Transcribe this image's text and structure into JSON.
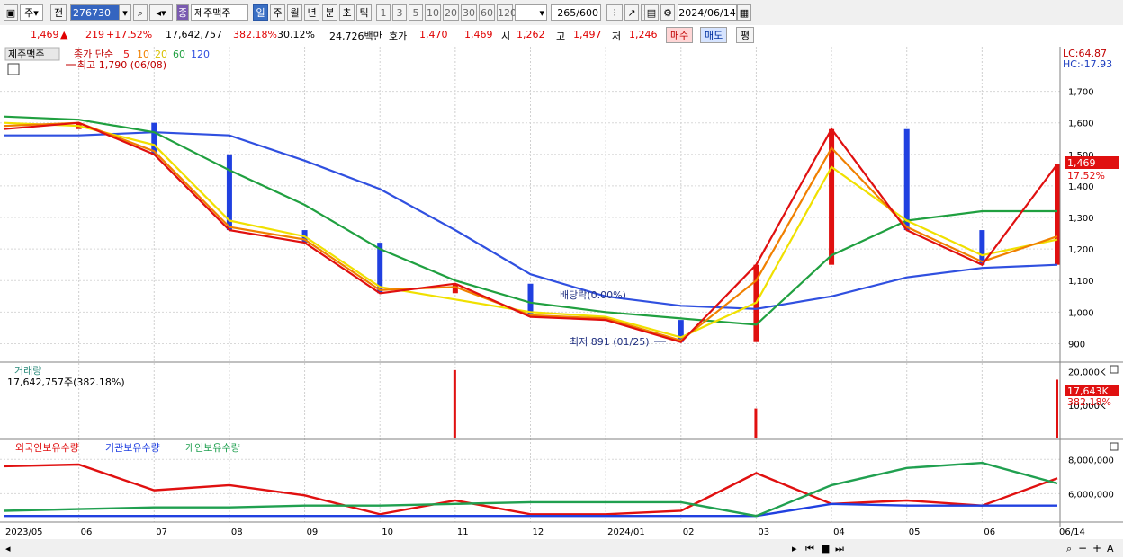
{
  "toolbar": {
    "market": "주",
    "prev": "전",
    "code": "276730",
    "name": "제주맥주",
    "name_badge": "종",
    "periods": [
      "일",
      "주",
      "월",
      "년",
      "분",
      "초",
      "틱"
    ],
    "active_period": "일",
    "intervals": [
      "1",
      "3",
      "5",
      "10",
      "20",
      "30",
      "60",
      "120"
    ],
    "count": "265",
    "count_total": "/600",
    "date": "2024/06/14"
  },
  "quote": {
    "price": "1,469",
    "change": "219",
    "change_arrow": "▲",
    "change_pct": "+17.52%",
    "volume": "17,642,757",
    "volume_ratio": "382.18%",
    "turnover": "30.12%",
    "amount": "24,726백만",
    "ask_label": "호가",
    "ask": "1,470",
    "bid": "1,469",
    "open_label": "시",
    "open": "1,262",
    "high_label": "고",
    "high": "1,497",
    "low_label": "저",
    "low": "1,246",
    "buy_btn": "매수",
    "sell_btn": "매도",
    "eval_btn": "평"
  },
  "price_panel": {
    "title": "제주맥주",
    "ma_label": "종가 단순",
    "ma_periods": [
      "5",
      "10",
      "20",
      "60",
      "120"
    ],
    "ma_colors": [
      "#e01010",
      "#f08000",
      "#f0e000",
      "#20a040",
      "#3050e0"
    ],
    "high_marker": "최고 1,790 (06/08)",
    "low_marker": "최저 891 (01/25)",
    "dividend_marker": "배당락(0.00%)",
    "lc_label": "LC:64.87",
    "hc_label": "HC:-17.93",
    "price_tag": "1,469",
    "pct_tag": "17.52%"
  },
  "volume_panel": {
    "title": "거래량",
    "value_text": "17,642,757주(382.18%)",
    "tag": "17,643K",
    "tag_pct": "382.18%"
  },
  "holding_panel": {
    "series_labels": [
      "외국인보유수량",
      "기관보유수량",
      "개인보유수량"
    ],
    "series_colors": [
      "#e01010",
      "#2040e0",
      "#20a050"
    ]
  },
  "x_axis": {
    "labels": [
      "2023/05",
      "06",
      "07",
      "08",
      "09",
      "10",
      "11",
      "12",
      "2024/01",
      "02",
      "03",
      "04",
      "05",
      "06",
      "06/14"
    ]
  },
  "chart_data": [
    {
      "type": "line",
      "title": "제주맥주",
      "y_ticks": [
        "1,700",
        "1,600",
        "1,500",
        "1,400",
        "1,300",
        "1,200",
        "1,100",
        "1,000",
        "900"
      ],
      "ylim": [
        850,
        1790
      ],
      "x": [
        "2023/05",
        "2023/06",
        "2023/07",
        "2023/08",
        "2023/09",
        "2023/10",
        "2023/11",
        "2023/12",
        "2024/01",
        "2024/02",
        "2024/03",
        "2024/04",
        "2024/05",
        "2024/06",
        "06/14"
      ],
      "series": [
        {
          "name": "5",
          "values": [
            1580,
            1600,
            1500,
            1260,
            1220,
            1060,
            1090,
            985,
            975,
            905,
            1150,
            1580,
            1260,
            1150,
            1469
          ]
        },
        {
          "name": "10",
          "values": [
            1590,
            1600,
            1510,
            1270,
            1230,
            1070,
            1080,
            990,
            980,
            910,
            1100,
            1520,
            1270,
            1160,
            1240
          ]
        },
        {
          "name": "20",
          "values": [
            1600,
            1590,
            1530,
            1290,
            1240,
            1080,
            1040,
            1000,
            985,
            920,
            1030,
            1460,
            1290,
            1180,
            1230
          ]
        },
        {
          "name": "60",
          "values": [
            1620,
            1610,
            1570,
            1450,
            1340,
            1200,
            1100,
            1030,
            1000,
            980,
            960,
            1180,
            1290,
            1320,
            1320
          ]
        },
        {
          "name": "120",
          "values": [
            1560,
            1560,
            1570,
            1560,
            1480,
            1390,
            1260,
            1120,
            1050,
            1020,
            1010,
            1050,
            1110,
            1140,
            1150
          ]
        }
      ],
      "annotations": [
        "최고 1,790 (06/08)",
        "최저 891 (01/25)",
        "배당락(0.00%)"
      ]
    },
    {
      "type": "bar",
      "title": "거래량",
      "y_ticks": [
        "20,000K",
        "10,000K"
      ],
      "ylim": [
        0,
        21000
      ],
      "spikes": [
        {
          "x": "2023/11",
          "value": 20500
        },
        {
          "x": "2024/03",
          "value": 9000
        },
        {
          "x": "06/14",
          "value": 17643
        }
      ]
    },
    {
      "type": "line",
      "title": "외국인보유수량 기관보유수량 개인보유수량",
      "y_ticks": [
        "8,000,000",
        "6,000,000"
      ],
      "ylim": [
        4500000,
        8800000
      ],
      "x": [
        "2023/05",
        "2023/06",
        "2023/07",
        "2023/08",
        "2023/09",
        "2023/10",
        "2023/11",
        "2023/12",
        "2024/01",
        "2024/02",
        "2024/03",
        "2024/04",
        "2024/05",
        "2024/06",
        "06/14"
      ],
      "series": [
        {
          "name": "외국인보유수량",
          "values": [
            7600,
            7700,
            6200,
            6500,
            5900,
            4800,
            5600,
            4800,
            4800,
            5000,
            7200,
            5400,
            5600,
            5300,
            6900
          ]
        },
        {
          "name": "기관보유수량",
          "values": [
            4700,
            4700,
            4700,
            4700,
            4700,
            4700,
            4700,
            4700,
            4700,
            4700,
            4700,
            5400,
            5300,
            5300,
            5300
          ]
        },
        {
          "name": "개인보유수량",
          "values": [
            5000,
            5100,
            5200,
            5200,
            5300,
            5300,
            5400,
            5500,
            5500,
            5500,
            4700,
            6500,
            7500,
            7800,
            6600
          ]
        }
      ]
    }
  ]
}
